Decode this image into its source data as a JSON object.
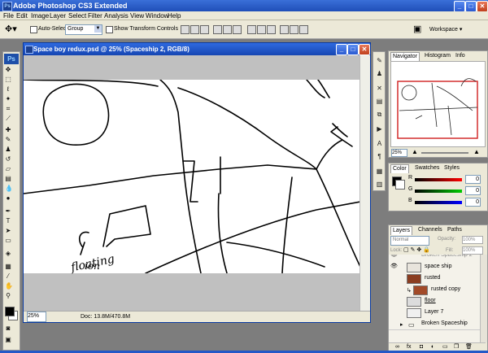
{
  "app": {
    "title": "Adobe Photoshop CS3 Extended",
    "logo": "Ps",
    "colors": {
      "titlebar": "#2458c7",
      "canvas_border": "#c0c0c0"
    }
  },
  "window_buttons": {
    "minimize": "_",
    "maximize": "□",
    "close": "✕"
  },
  "menu": [
    "File",
    "Edit",
    "Image",
    "Layer",
    "Select",
    "Filter",
    "Analysis",
    "View",
    "Window",
    "Help"
  ],
  "options_bar": {
    "auto_select_label": "Auto-Select:",
    "auto_select_value": "Group",
    "show_transform_label": "Show Transform Controls",
    "workspace_label": "Workspace ▾"
  },
  "document": {
    "title": "Space boy redux.psd @ 25% (Spaceship 2, RGB/8)",
    "zoom": "25%",
    "doc_size": "Doc: 13.8M/470.8M",
    "text_marks": [
      "floating",
      "ion"
    ]
  },
  "navigator": {
    "tabs": [
      "Navigator",
      "Histogram",
      "Info"
    ],
    "zoom": "25%"
  },
  "color_panel": {
    "tabs": [
      "Color",
      "Swatches",
      "Styles"
    ],
    "channels": [
      {
        "label": "R",
        "value": "0"
      },
      {
        "label": "G",
        "value": "0"
      },
      {
        "label": "B",
        "value": "0"
      }
    ]
  },
  "layers_panel": {
    "tabs": [
      "Layers",
      "Channels",
      "Paths"
    ],
    "blend_mode": "Normal",
    "opacity_label": "Opacity:",
    "opacity_value": "100%",
    "lock_label": "Lock:",
    "fill_label": "Fill:",
    "fill_value": "100%",
    "layers": [
      {
        "name": "Broken Spaceship 2",
        "visible": true,
        "type": "group-partial"
      },
      {
        "name": "space ship",
        "visible": true,
        "type": "layer"
      },
      {
        "name": "rusted",
        "visible": false,
        "type": "layer"
      },
      {
        "name": "rusted copy",
        "visible": false,
        "type": "layer"
      },
      {
        "name": "floor",
        "visible": false,
        "type": "layer"
      },
      {
        "name": "Layer 7",
        "visible": false,
        "type": "layer"
      },
      {
        "name": "Broken Spaceship",
        "visible": false,
        "type": "group"
      }
    ]
  }
}
